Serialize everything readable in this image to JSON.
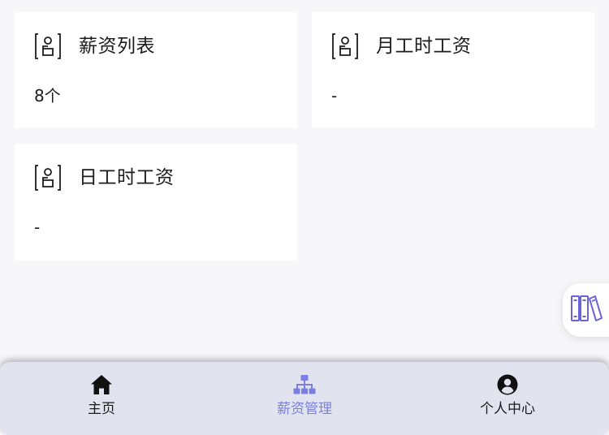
{
  "cards": [
    {
      "title": "薪资列表",
      "value": "8个"
    },
    {
      "title": "月工时工资",
      "value": "-"
    },
    {
      "title": "日工时工资",
      "value": "-"
    }
  ],
  "float_button": {
    "icon": "books-icon"
  },
  "tabbar": {
    "tabs": [
      {
        "label": "主页",
        "icon": "home-icon",
        "active": false
      },
      {
        "label": "薪资管理",
        "icon": "sitemap-icon",
        "active": true
      },
      {
        "label": "个人中心",
        "icon": "user-circle-icon",
        "active": false
      }
    ]
  },
  "colors": {
    "accent": "#7b7fe0",
    "float_icon": "#6a63d8",
    "background": "#f7f7fa",
    "tabbar_bg": "#e1e4ee"
  }
}
